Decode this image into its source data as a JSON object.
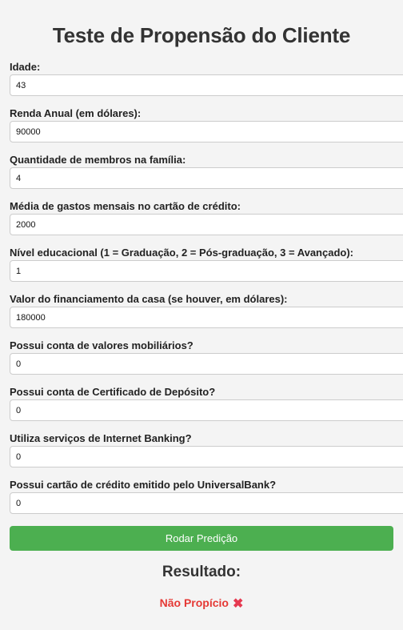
{
  "page": {
    "title": "Teste de Propensão do Cliente"
  },
  "form": {
    "fields": [
      {
        "name": "idade",
        "label": "Idade:",
        "value": "43"
      },
      {
        "name": "renda-anual",
        "label": "Renda Anual (em dólares):",
        "value": "90000"
      },
      {
        "name": "membros-familia",
        "label": "Quantidade de membros na família:",
        "value": "4"
      },
      {
        "name": "gastos-cartao",
        "label": "Média de gastos mensais no cartão de crédito:",
        "value": "2000"
      },
      {
        "name": "nivel-educacional",
        "label": "Nível educacional (1 = Graduação, 2 = Pós-graduação, 3 = Avançado):",
        "value": "1"
      },
      {
        "name": "financiamento-casa",
        "label": "Valor do financiamento da casa (se houver, em dólares):",
        "value": "180000"
      },
      {
        "name": "valores-mobiliarios",
        "label": "Possui conta de valores mobiliários?",
        "value": "0"
      },
      {
        "name": "certificado-deposito",
        "label": "Possui conta de Certificado de Depósito?",
        "value": "0"
      },
      {
        "name": "internet-banking",
        "label": "Utiliza serviços de Internet Banking?",
        "value": "0"
      },
      {
        "name": "cartao-universalbank",
        "label": "Possui cartão de crédito emitido pelo UniversalBank?",
        "value": "0"
      }
    ],
    "submit_label": "Rodar Predição"
  },
  "result": {
    "heading": "Resultado:",
    "value": "Não Propício",
    "icon": "cross-mark-icon",
    "icon_glyph": "✖",
    "color": "#e53935"
  },
  "colors": {
    "background": "#f4f4f4",
    "button": "#4caf50",
    "negative": "#e53935"
  }
}
